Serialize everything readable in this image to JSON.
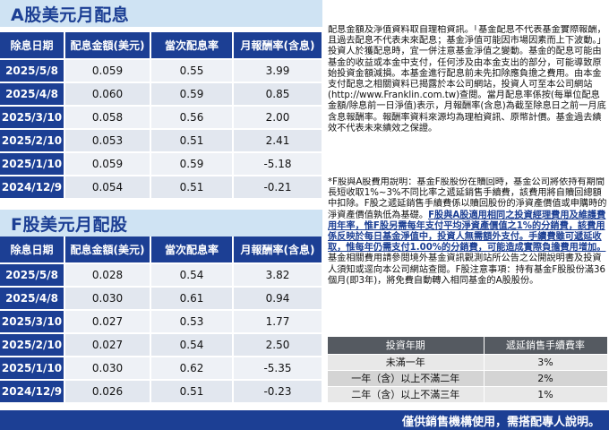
{
  "a_share": {
    "title": "A股美元月配息",
    "headers": [
      "除息日期",
      "配息金額(美元)",
      "當次配息率",
      "月報酬率(含息)"
    ],
    "rows": [
      [
        "2025/5/8",
        "0.059",
        "0.55",
        "3.99"
      ],
      [
        "2025/4/8",
        "0.060",
        "0.59",
        "0.85"
      ],
      [
        "2025/3/10",
        "0.058",
        "0.56",
        "2.00"
      ],
      [
        "2025/2/10",
        "0.053",
        "0.51",
        "2.41"
      ],
      [
        "2025/1/10",
        "0.059",
        "0.59",
        "-5.18"
      ],
      [
        "2024/12/9",
        "0.054",
        "0.51",
        "-0.21"
      ]
    ]
  },
  "f_share": {
    "title": "F股美元月配股",
    "headers": [
      "除息日期",
      "配息金額(美元)",
      "當次配息率",
      "月報酬率(含息)"
    ],
    "rows": [
      [
        "2025/5/8",
        "0.028",
        "0.54",
        "3.82"
      ],
      [
        "2025/4/8",
        "0.030",
        "0.61",
        "0.94"
      ],
      [
        "2025/3/10",
        "0.027",
        "0.53",
        "1.77"
      ],
      [
        "2025/2/10",
        "0.027",
        "0.54",
        "2.50"
      ],
      [
        "2025/1/10",
        "0.030",
        "0.62",
        "-5.35"
      ],
      [
        "2024/12/9",
        "0.026",
        "0.51",
        "-0.23"
      ]
    ]
  },
  "notes": {
    "distribution": "配息金額及淨值資料取自理柏資訊。「基金配息不代表基金實際報酬，且過去配息不代表未來配息；基金淨值可能因市場因素而上下波動。」投資人於獲配息時，宜一併注意基金淨值之變動。基金的配息可能由基金的收益或本金中支付，任何涉及由本金支出的部分，可能導致原始投資金額減損。本基金進行配息前未先扣除應負擔之費用。由本金支付配息之相關資料已揭露於本公司網站，投資人可至本公司網站(http://www.Franklin.com.tw)查閱。當月配息率係按(每單位配息金額/除息前一日淨值)表示，月報酬率(含息)為截至除息日之前一月底含息報酬率。報酬率資料來源均為理柏資訊、原幣計價。基金過去績效不代表未來績效之保證。",
    "fee_part1": "*F股與A股費用說明：基金F股股份在贖回時，基金公司將依持有期間長短收取1%~3%不同比率之遞延銷售手續費，該費用將自贖回總額中扣除。F股之遞延銷售手續費係以贖回股份的淨資產價值或申購時的淨資產價值孰低為基礎。",
    "fee_highlight": "F股與A股適用相同之投資經理費用及維護費用年率，惟F股另需每年支付平均淨資產價值之1%的分銷費，該費用係反映於每日基金淨值中，投資人無需額外支付。手續費雖可遞延收取，惟每年仍需支付1.00%的分銷費，可能造成實際負擔費用增加。",
    "fee_part2": "基金相關費用請參閱境外基金資訊觀測站所公告之公開說明書及投資人須知或逕向本公司網站查閱。F股注意事項：持有基金F股股份滿36個月(即3年)，將免費自動轉入相同基金的A股股份。"
  },
  "fee_table": {
    "headers": [
      "投資年期",
      "遞延銷售手續費率"
    ],
    "rows": [
      [
        "未滿一年",
        "3%"
      ],
      [
        "一年（含）以上不滿二年",
        "2%"
      ],
      [
        "二年（含）以上不滿三年",
        "1%"
      ]
    ]
  },
  "footer": {
    "text": "僅供銷售機構使用，需搭配專人說明。"
  },
  "colors": {
    "brand_navy": "#1c3f94",
    "title_band": "#cfe3f3",
    "row_light": "#eef1f6",
    "row_dark": "#e2e7ef"
  }
}
